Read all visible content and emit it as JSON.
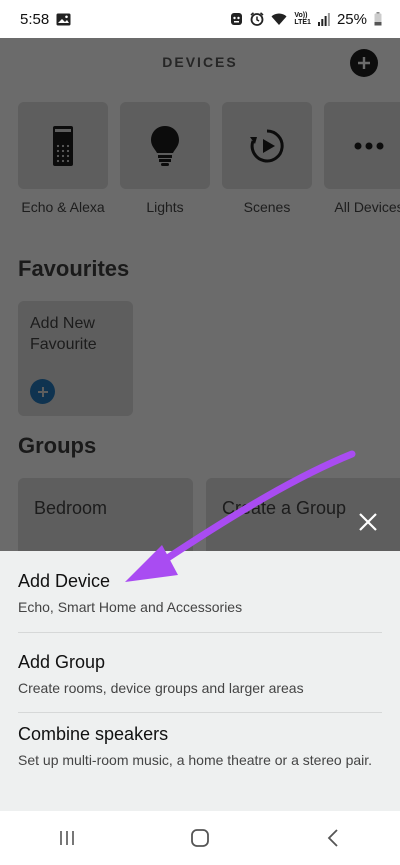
{
  "status": {
    "time": "5:58",
    "battery": "25%",
    "network": "LTE1",
    "carrier_badge": "Vo))",
    "icons": [
      "gallery-icon",
      "face-icon",
      "alarm-icon",
      "wifi-icon",
      "signal-icon",
      "battery-icon"
    ]
  },
  "header": {
    "title": "DEVICES",
    "add_icon": "plus-icon"
  },
  "categories": [
    {
      "label": "Echo & Alexa",
      "icon": "echo-speaker-icon"
    },
    {
      "label": "Lights",
      "icon": "bulb-icon"
    },
    {
      "label": "Scenes",
      "icon": "scene-play-icon"
    },
    {
      "label": "All Devices",
      "icon": "more-dots-icon"
    }
  ],
  "favourites": {
    "title": "Favourites",
    "card_label": "Add New Favourite"
  },
  "groups": {
    "title": "Groups",
    "items": [
      "Bedroom",
      "Create a Group"
    ]
  },
  "sheet": {
    "options": [
      {
        "title": "Add Device",
        "subtitle": "Echo, Smart Home and Accessories"
      },
      {
        "title": "Add Group",
        "subtitle": "Create rooms, device groups and larger areas"
      },
      {
        "title": "Combine speakers",
        "subtitle": "Set up multi-room music, a home theatre or a stereo pair."
      }
    ]
  },
  "colors": {
    "annotation_arrow": "#a94cf2",
    "overlay": "#6b6b6b",
    "sheet": "#eef0f0"
  }
}
